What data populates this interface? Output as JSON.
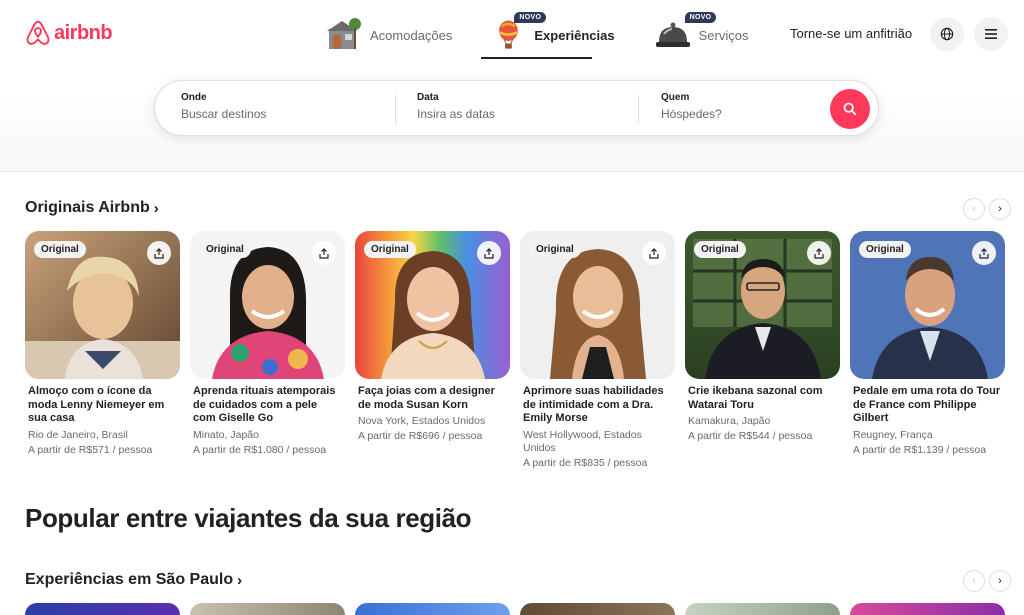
{
  "brand": {
    "name": "airbnb",
    "color": "#ff385c"
  },
  "tabs": [
    {
      "label": "Acomodações",
      "icon": "house-icon",
      "badge": ""
    },
    {
      "label": "Experiências",
      "icon": "hot-air-balloon-icon",
      "badge": "NOVO"
    },
    {
      "label": "Serviços",
      "icon": "service-bell-icon",
      "badge": "NOVO"
    }
  ],
  "header": {
    "host_link": "Torne-se um anfitrião"
  },
  "search": {
    "where": {
      "label": "Onde",
      "placeholder": "Buscar destinos"
    },
    "date": {
      "label": "Data",
      "placeholder": "Insira as datas"
    },
    "who": {
      "label": "Quem",
      "placeholder": "Hóspedes?"
    }
  },
  "originals": {
    "title": "Originais Airbnb",
    "cards": [
      {
        "badge": "Original",
        "title": "Almoço com o ícone da moda Lenny Niemeyer em sua casa",
        "location": "Rio de Janeiro, Brasil",
        "price": "A partir de R$571 / pessoa"
      },
      {
        "badge": "Original",
        "title": "Aprenda rituais atemporais de cuidados com a pele com Giselle Go",
        "location": "Minato, Japão",
        "price": "A partir de R$1.080 / pessoa"
      },
      {
        "badge": "Original",
        "title": "Faça joias com a designer de moda Susan Korn",
        "location": "Nova York, Estados Unidos",
        "price": "A partir de R$696 / pessoa"
      },
      {
        "badge": "Original",
        "title": "Aprimore suas habilidades de intimidade com a Dra. Emily Morse",
        "location": "West Hollywood, Estados Unidos",
        "price": "A partir de R$835 / pessoa"
      },
      {
        "badge": "Original",
        "title": "Crie ikebana sazonal com Watarai Toru",
        "location": "Kamakura, Japão",
        "price": "A partir de R$544 / pessoa"
      },
      {
        "badge": "Original",
        "title": "Pedale em uma rota do Tour de France com Philippe Gilbert",
        "location": "Reugney, França",
        "price": "A partir de R$1.139 / pessoa"
      }
    ]
  },
  "popular": {
    "heading": "Popular entre viajantes da sua região"
  },
  "sao_paulo": {
    "title": "Experiências em São Paulo"
  }
}
